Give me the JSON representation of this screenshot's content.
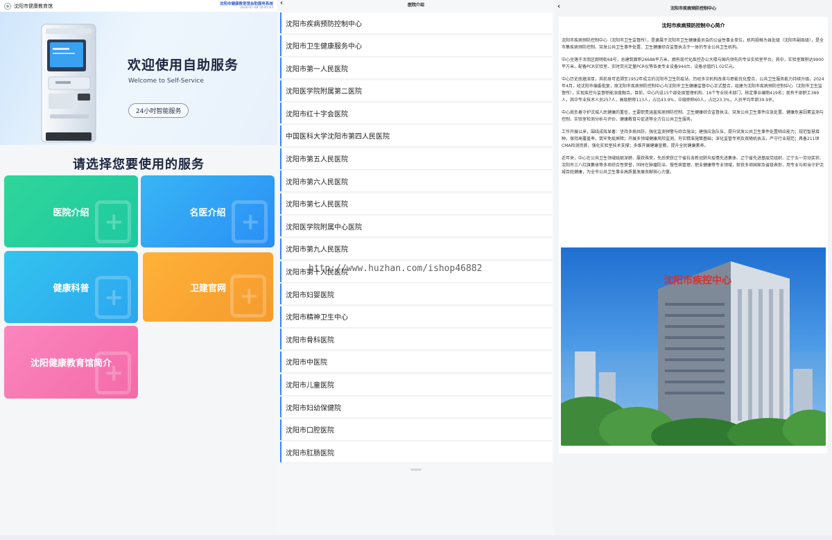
{
  "panel1": {
    "header": {
      "title": "沈阳市健康教育馆",
      "system_title": "沈阳市健康教育馆自助服务系统",
      "datetime": "2026-07-08 10:45:03"
    },
    "hero": {
      "title": "欢迎使用自助服务",
      "subtitle": "Welcome to Self-Service",
      "badge": "24小时智能服务"
    },
    "choose_title": "请选择您要使用的服务",
    "tiles": [
      {
        "label": "医院介绍",
        "color_from": "#2fd69a",
        "color_to": "#1ec9a0"
      },
      {
        "label": "名医介绍",
        "color_from": "#38b6f5",
        "color_to": "#2a8ef5"
      },
      {
        "label": "健康科普",
        "color_from": "#33c4ee",
        "color_to": "#2ba6f0"
      },
      {
        "label": "卫建官网",
        "color_from": "#ffb238",
        "color_to": "#f59a2e"
      },
      {
        "label": "沈阳健康教育馆简介",
        "color_from": "#fb86bd",
        "color_to": "#f46aa9"
      }
    ]
  },
  "panel2": {
    "header": {
      "title": "医院介绍"
    },
    "items": [
      "沈阳市疾病预防控制中心",
      "沈阳市卫生健康服务中心",
      "沈阳市第一人民医院",
      "沈阳医学院附属第二医院",
      "沈阳市红十字会医院",
      "中国医科大学沈阳市第四人民医院",
      "沈阳市第五人民医院",
      "沈阳市第六人民医院",
      "沈阳市第七人民医院",
      "沈阳医学院附属中心医院",
      "沈阳市第九人民医院",
      "沈阳市第十人民医院",
      "沈阳市妇婴医院",
      "沈阳市精神卫生中心",
      "沈阳市骨科医院",
      "沈阳市中医院",
      "沈阳市儿童医院",
      "沈阳市妇幼保健院",
      "沈阳市口腔医院",
      "沈阳市肛肠医院"
    ],
    "watermark": "http://www.huzhan.com/ishop46882"
  },
  "panel3": {
    "header": {
      "title": "沈阳市疾病预防控制中心"
    },
    "article_title": "沈阳市疾病预防控制中心简介",
    "paragraphs": [
      "沈阳市疾病预防控制中心（沈阳市卫生监督所），是隶属于沈阳市卫生健康委员会的公益性事业单位，机构规格为县处级（沈阳市副局级），是全市集疾病预防控制、突发公共卫生事件处置、卫生健康综合监督执法于一体的专业公共卫生机构。",
      "中心坐落于浑南区朗明街68号，总建筑面积26688平方米，拥有现代化疾控办公大楼与国内领先的专业实验室平台。其中，实验室面积达9900平方米，配备PCR实验室、实时荧光定量PCR仪等各类专业设备944台，设备总值约1.02亿元。",
      "中心历史底蕴深厚，其前身可追溯至1952年成立的沈阳市卫生防疫站，历经多次机构改革与职能优化整合，公共卫生服务能力持续升级。2024年4月，经沈阳市编委批复，原沈阳市疾病预防控制中心与沈阳市卫生健康监督中心正式整合，组建为沈阳市疾病预防控制中心（沈阳市卫生监督所），实现疾控与监督职能深度融合。目前，中心内设15个部处级管理机构、16个专业技术部门，核定事业编制419名；现有干部职工389人，其中专业技术人员257人，高级职称113人，占比43.9%，中级职称60人，占比23.3%，人员平均年龄39.9岁。",
      "中心肩负着守护沈城人民健康的重任，主要职责涵盖疾病预防控制、卫生健康综合监督执法、突发公共卫生事件应急处置、健康危害因素监测与控制、实验室检测分析与评价、健康教育与促进等全方位公共卫生服务。",
      "工作开展以来，围绕成效显著：坚持多病共防，强化监测预警与综合施治；建强应急队伍，提升突发公共卫生事件处置响应能力；规范智慧接种，保持高覆盖率，筑牢免疫屏障；开展多领域健康风险监测，夯实精准施策基础；深化监管专项及双随机执法，严守行业规范；具备211项CMA检测资质，强化实验室技术支撑；多维开展健康宣教，提升全民健康素养。",
      "近年来，中心在公共卫生领域砥砺深耕、屡获殊荣，先后荣获辽宁省抗击新冠肺炎疫情先进集体、辽宁省先进基层党组织、辽宁五一劳动奖状、沈阳市三八红旗集体等多项综合性荣誉，同时在肿瘤防治、慢性病管理、职业健康等专业领域，斩获多项国家及省级表彰，用专业与担当守护沈城百姓健康，为全市公共卫生事业高质量发展贡献核心力量。"
    ],
    "photo_sign": "沈阳市疾控中心"
  }
}
